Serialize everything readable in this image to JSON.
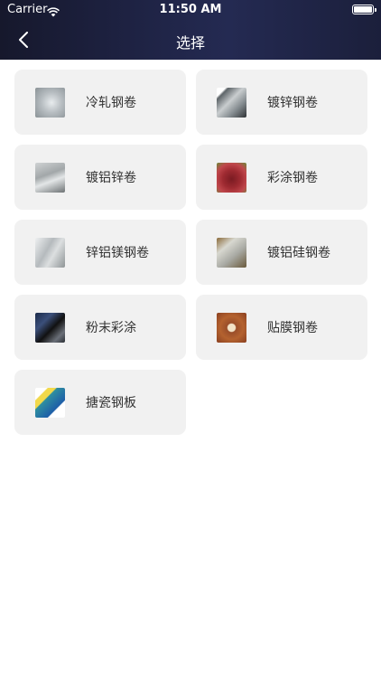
{
  "status_bar": {
    "carrier": "Carrier",
    "time": "11:50 AM"
  },
  "nav": {
    "title": "选择",
    "back_icon": "chevron-left-icon"
  },
  "products": [
    {
      "label": "冷轧钢卷"
    },
    {
      "label": "镀锌钢卷"
    },
    {
      "label": "镀铝锌卷"
    },
    {
      "label": "彩涂钢卷"
    },
    {
      "label": "锌铝镁钢卷"
    },
    {
      "label": "镀铝硅钢卷"
    },
    {
      "label": "粉末彩涂"
    },
    {
      "label": "贴膜钢卷"
    },
    {
      "label": "搪瓷钢板"
    }
  ],
  "colors": {
    "header_dark": "#16182c",
    "header_blue": "#242a52",
    "card_bg": "#f1f1f1",
    "label_text": "#333333"
  }
}
